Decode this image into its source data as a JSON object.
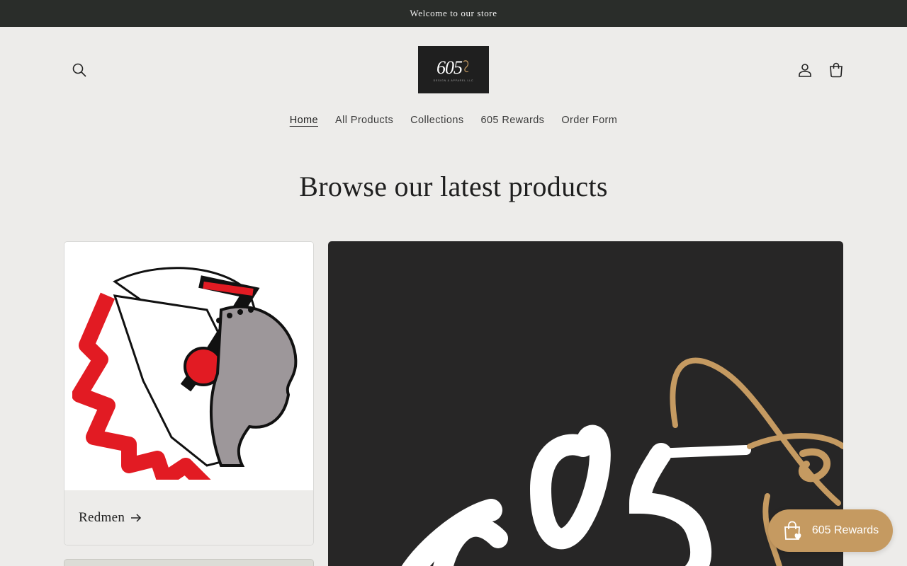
{
  "announcement": "Welcome to our store",
  "logo": {
    "text": "605",
    "subtext": "Design & Apparel LLC"
  },
  "nav": [
    {
      "label": "Home",
      "active": true
    },
    {
      "label": "All Products",
      "active": false
    },
    {
      "label": "Collections",
      "active": false
    },
    {
      "label": "605 Rewards",
      "active": false
    },
    {
      "label": "Order Form",
      "active": false
    }
  ],
  "heading": "Browse our latest products",
  "products": [
    {
      "title": "Redmen",
      "icon": "arrow-right-icon"
    }
  ],
  "rewards_button": {
    "label": "605 Rewards",
    "icon": "shopping-bag-heart-icon"
  },
  "colors": {
    "announcement_bg": "#2a2d2a",
    "page_bg": "#edecea",
    "rewards_accent": "#c59a61",
    "feature_bg": "#272626"
  }
}
